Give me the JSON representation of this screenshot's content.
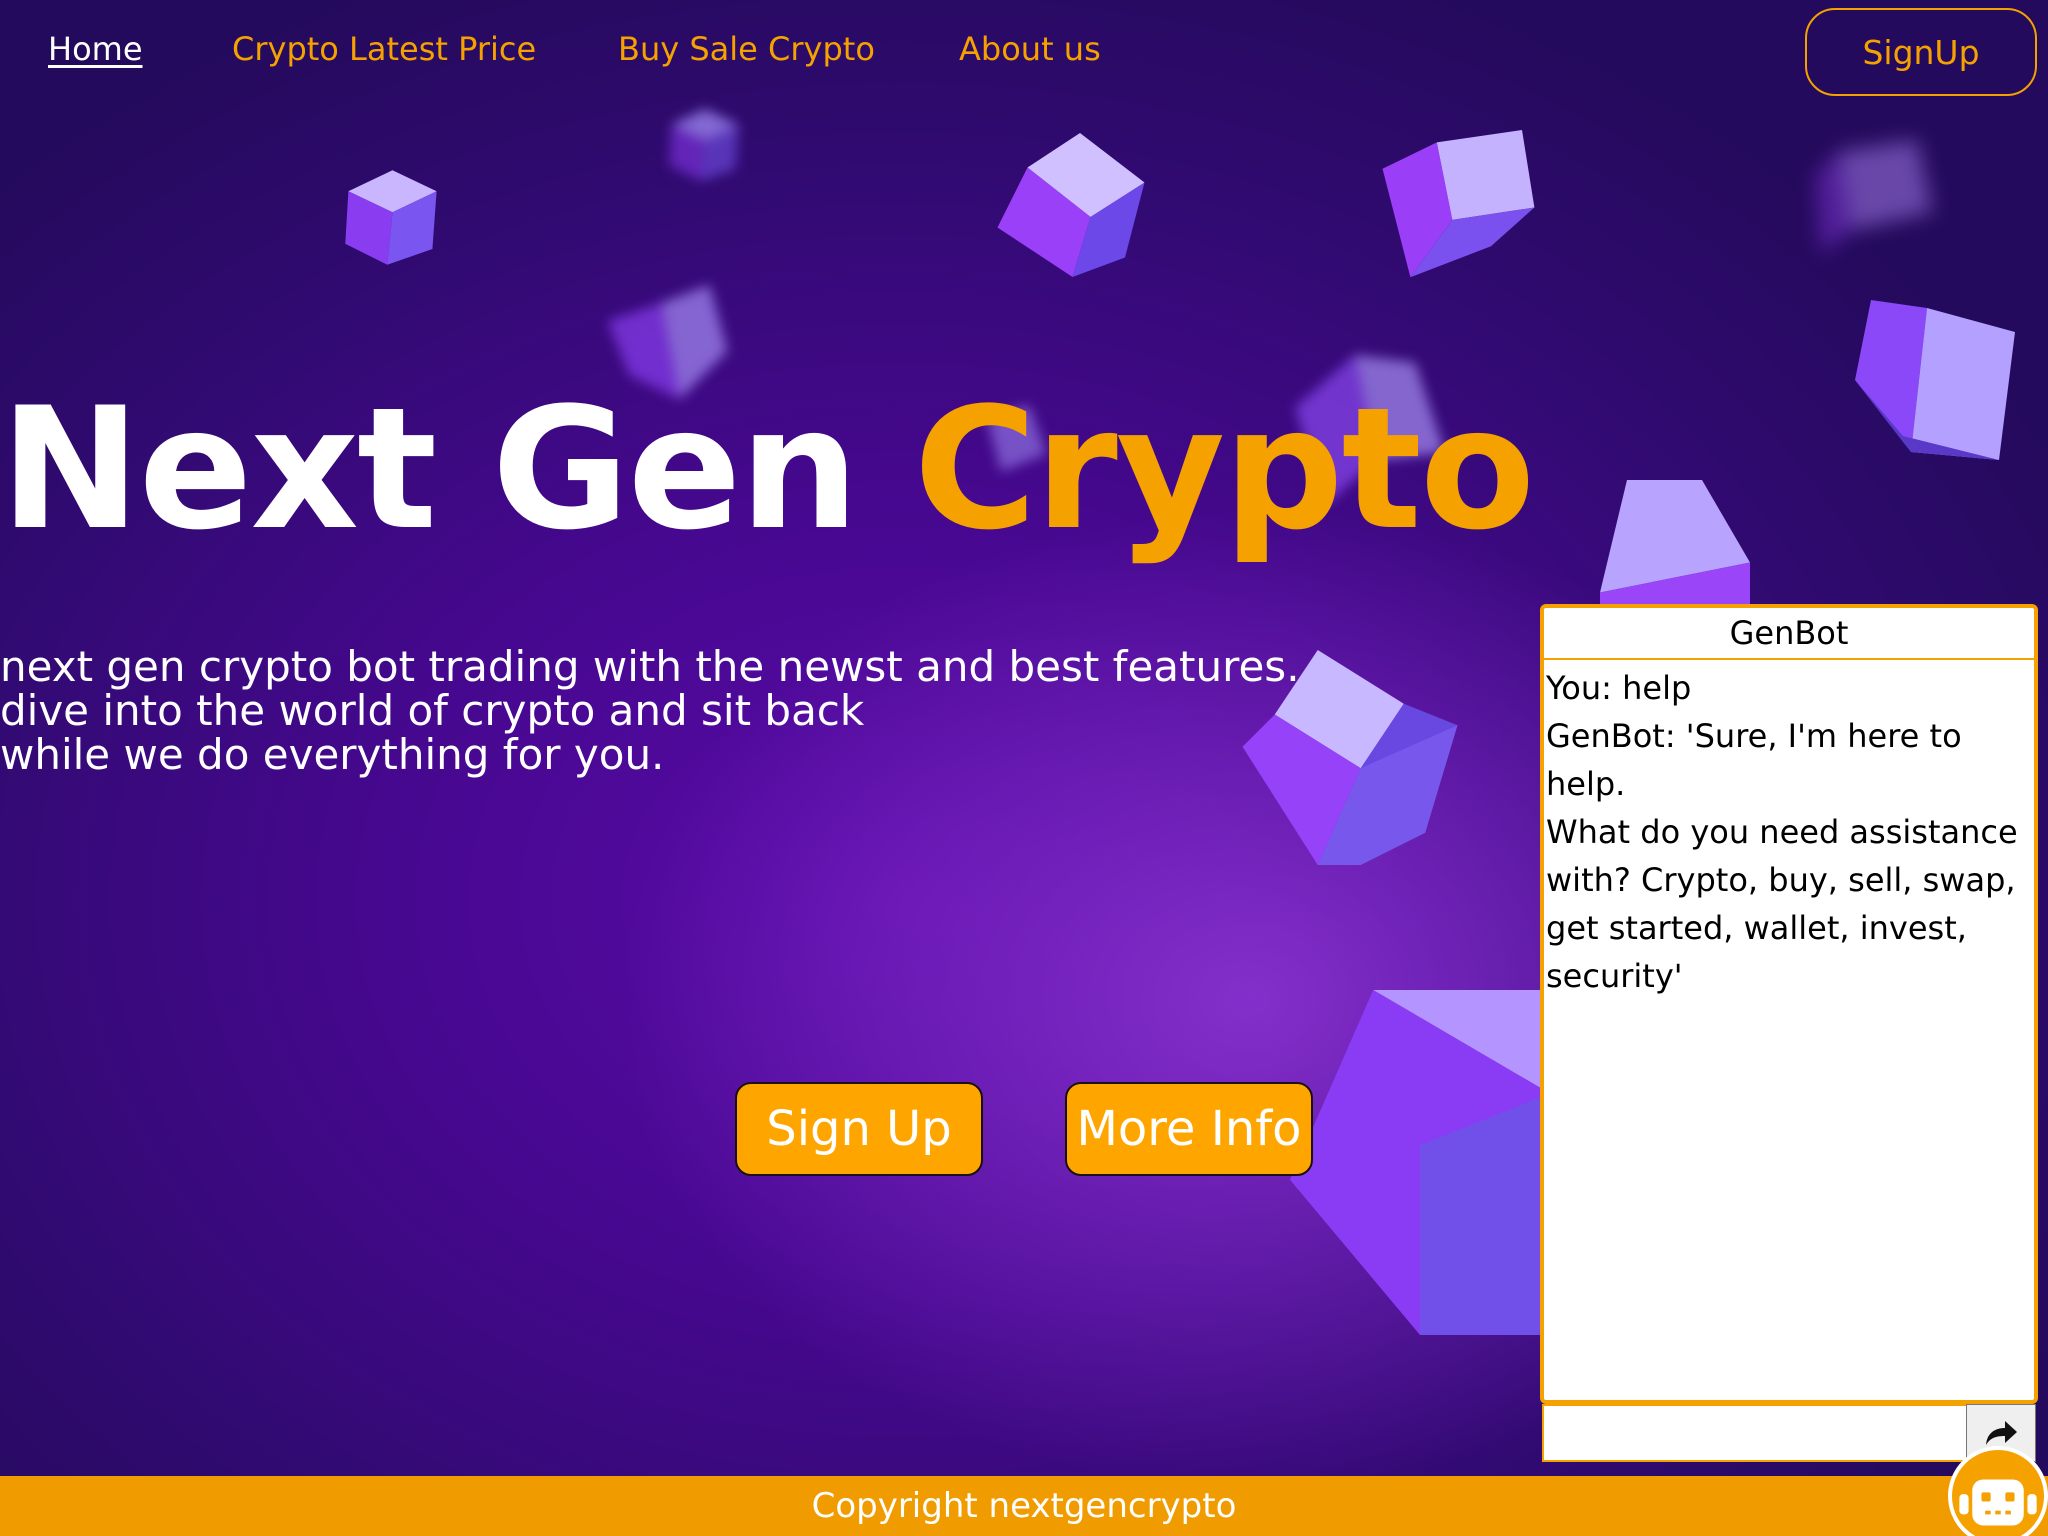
{
  "nav": {
    "items": [
      {
        "label": "Home",
        "active": true
      },
      {
        "label": "Crypto Latest Price",
        "active": false
      },
      {
        "label": "Buy Sale Crypto",
        "active": false
      },
      {
        "label": "About us",
        "active": false
      }
    ],
    "signup_label": "SignUp"
  },
  "hero": {
    "title_main": "Next Gen",
    "title_accent": "Crypto",
    "subtitle_lines": [
      "next gen crypto bot trading with the newst and best features.",
      "dive into the world of crypto and sit back",
      "while we do everything for you."
    ],
    "signup_button": "Sign Up",
    "more_info_button": "More Info"
  },
  "chat": {
    "title": "GenBot",
    "messages": [
      "You: help",
      "GenBot: 'Sure, I'm here to help.",
      "What do you need assistance",
      "with? Crypto, buy, sell, swap,",
      "get started, wallet, invest,",
      "security'"
    ],
    "input_value": "",
    "input_placeholder": "",
    "send_icon": "share-arrow-icon",
    "launcher_icon": "robot-icon"
  },
  "footer": {
    "text": "Copyright nextgencrypto"
  },
  "colors": {
    "accent": "#f5a100",
    "background_dark": "#2a0a66",
    "background_mid": "#5a0aa8",
    "text_light": "#ffffff"
  }
}
